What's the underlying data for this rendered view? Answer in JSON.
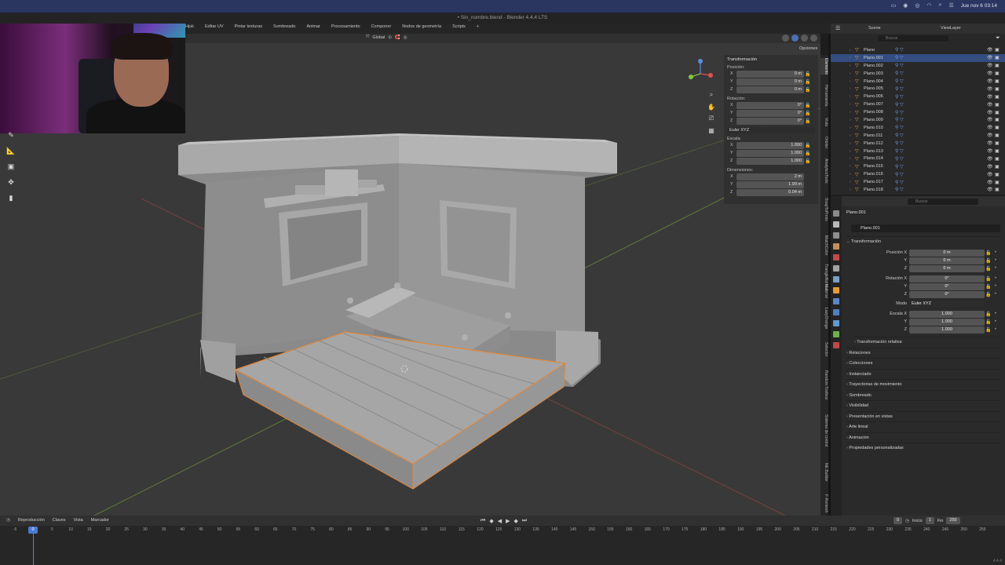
{
  "window": {
    "title": "• Sin_nombre.blend - Blender 4.4.4 LTS",
    "clock": "Jue nov 6  03:14"
  },
  "menus": [
    "Editar UV",
    "Pintar texturas",
    "Sombreado",
    "Animar",
    "Procesamiento",
    "Componer",
    "Nodos de geometría",
    "Scripts",
    "+"
  ],
  "menu_prefix": "Hjuk",
  "viewport": {
    "transform_orientation": "Global",
    "options_label": "Opciones"
  },
  "npanel": {
    "section": "Transformación",
    "position_label": "Posición:",
    "position": {
      "x": "0 m",
      "y": "0 m",
      "z": "0 m"
    },
    "rotation_label": "Rotación:",
    "rotation": {
      "x": "0°",
      "y": "0°",
      "z": "0°"
    },
    "rotation_mode": "Euler XYZ",
    "scale_label": "Escala:",
    "scale": {
      "x": "1.000",
      "y": "1.000",
      "z": "1.000"
    },
    "dimensions_label": "Dimensiones:",
    "dimensions": {
      "x": "2 m",
      "y": "1.99 m",
      "z": "0.04 m"
    }
  },
  "vtabs": [
    "Elemento",
    "Herramienta",
    "Vista",
    "Orbiter",
    "AnalyticsTools",
    "SnapToPrims",
    "MatchColor",
    "TriangleNormal",
    "Material",
    "LazyOrange",
    "Selector",
    "Random Toolbox",
    "Sistema de control",
    "NE Builder",
    "F-Remesh"
  ],
  "outliner": {
    "scene": "Scene",
    "view_layer": "ViewLayer",
    "search_placeholder": "Buscar",
    "items": [
      {
        "name": "Plano",
        "selected": false
      },
      {
        "name": "Plano.001",
        "selected": true
      },
      {
        "name": "Plano.002",
        "selected": false
      },
      {
        "name": "Plano.003",
        "selected": false
      },
      {
        "name": "Plano.004",
        "selected": false
      },
      {
        "name": "Plano.005",
        "selected": false
      },
      {
        "name": "Plano.006",
        "selected": false
      },
      {
        "name": "Plano.007",
        "selected": false
      },
      {
        "name": "Plano.008",
        "selected": false
      },
      {
        "name": "Plano.009",
        "selected": false
      },
      {
        "name": "Plano.010",
        "selected": false
      },
      {
        "name": "Plano.011",
        "selected": false
      },
      {
        "name": "Plano.012",
        "selected": false
      },
      {
        "name": "Plano.013",
        "selected": false
      },
      {
        "name": "Plano.014",
        "selected": false
      },
      {
        "name": "Plano.015",
        "selected": false
      },
      {
        "name": "Plano.016",
        "selected": false
      },
      {
        "name": "Plano.017",
        "selected": false
      },
      {
        "name": "Plano.018",
        "selected": false
      }
    ]
  },
  "properties": {
    "search_placeholder": "Buscar",
    "object_name": "Plano.001",
    "object_field": "Plano.001",
    "transform_section": "Transformación",
    "position_label": "Posición X",
    "position": [
      "0 m",
      "0 m",
      "0 m"
    ],
    "rotation_label": "Rotación X",
    "rotation": [
      "0°",
      "0°",
      "0°"
    ],
    "mode_label": "Modo",
    "mode_value": "Euler XYZ",
    "scale_label": "Escala X",
    "scale": [
      "1.000",
      "1.000",
      "1.000"
    ],
    "axis_y": "Y",
    "axis_z": "Z",
    "sections": [
      "Transformación relativa",
      "Relaciones",
      "Colecciones",
      "Instanciado",
      "Trayectorias de movimiento",
      "Sombreado",
      "Visibilidad",
      "Presentación en vistas",
      "Arte lineal",
      "Animación",
      "Propiedades personalizadas"
    ]
  },
  "timeline": {
    "menus": [
      "Reproducción",
      "Claves",
      "Vista",
      "Marcador"
    ],
    "current_frame": "0",
    "playhead_frame": "0",
    "start_label": "Inicio",
    "start": "1",
    "end_label": "Fin",
    "end": "250",
    "ticks": [
      "-5",
      "0",
      "5",
      "10",
      "15",
      "20",
      "25",
      "30",
      "35",
      "40",
      "45",
      "50",
      "55",
      "60",
      "65",
      "70",
      "75",
      "80",
      "85",
      "90",
      "95",
      "100",
      "105",
      "110",
      "115",
      "120",
      "125",
      "130",
      "135",
      "140",
      "145",
      "150",
      "155",
      "160",
      "165",
      "170",
      "175",
      "180",
      "185",
      "190",
      "195",
      "200",
      "205",
      "210",
      "215",
      "220",
      "225",
      "230",
      "235",
      "240",
      "245",
      "250",
      "255"
    ]
  },
  "version": "4.4.4"
}
